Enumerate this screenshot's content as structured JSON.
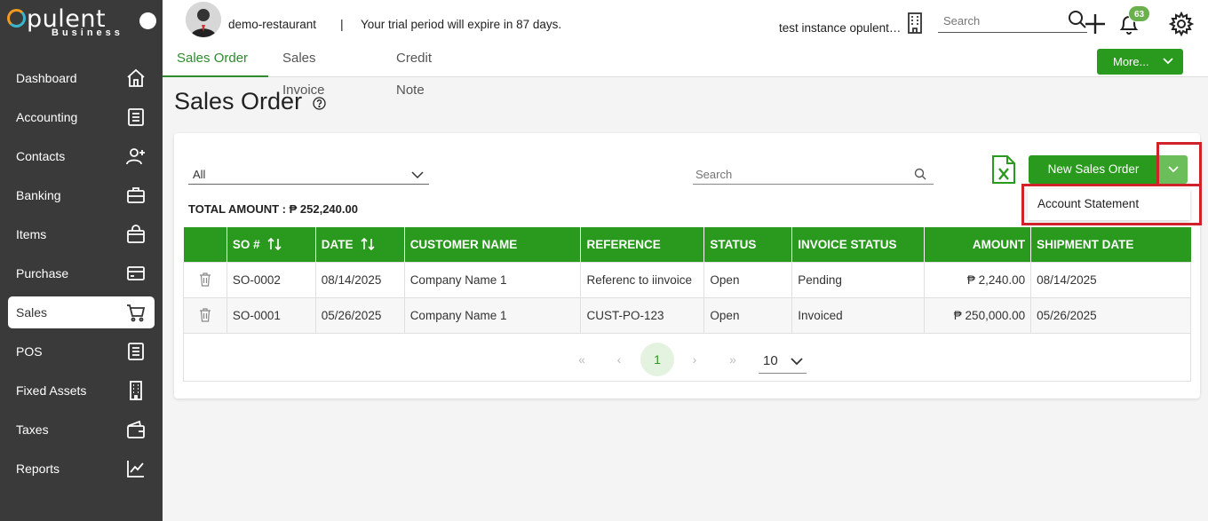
{
  "brand": {
    "name": "opulent",
    "sub": "Business"
  },
  "sidebar": {
    "items": [
      {
        "label": "Dashboard",
        "icon": "home-icon"
      },
      {
        "label": "Accounting",
        "icon": "ledger-icon"
      },
      {
        "label": "Contacts",
        "icon": "user-plus-icon"
      },
      {
        "label": "Banking",
        "icon": "briefcase-icon"
      },
      {
        "label": "Items",
        "icon": "shopping-bag-icon"
      },
      {
        "label": "Purchase",
        "icon": "credit-card-icon"
      },
      {
        "label": "Sales",
        "icon": "cart-icon",
        "active": true
      },
      {
        "label": "POS",
        "icon": "ledger-icon"
      },
      {
        "label": "Fixed Assets",
        "icon": "building-icon"
      },
      {
        "label": "Taxes",
        "icon": "wallet-icon"
      },
      {
        "label": "Reports",
        "icon": "chart-icon"
      }
    ]
  },
  "header": {
    "org": "demo-restaurant",
    "separator": "|",
    "trial": "Your trial period will expire in 87 days.",
    "instance": "test instance opulent business",
    "search_placeholder": "Search",
    "notification_count": "63"
  },
  "tabs": [
    "Sales Order",
    "Sales Invoice",
    "Credit Note"
  ],
  "more_label": "More...",
  "page": {
    "title": "Sales Order",
    "filter_value": "All",
    "search_placeholder": "Search",
    "new_button": "New Sales Order",
    "dropdown_item": "Account Statement",
    "total_label": "TOTAL AMOUNT : ₱ 252,240.00"
  },
  "table": {
    "columns": [
      "SO #",
      "DATE",
      "CUSTOMER NAME",
      "REFERENCE",
      "STATUS",
      "INVOICE STATUS",
      "AMOUNT",
      "SHIPMENT DATE"
    ],
    "rows": [
      {
        "so": "SO-0002",
        "date": "08/14/2025",
        "customer": "Company Name 1",
        "reference": "Referenc to iinvoice",
        "status": "Open",
        "invoice_status": "Pending",
        "amount": "₱ 2,240.00",
        "shipment": "08/14/2025"
      },
      {
        "so": "SO-0001",
        "date": "05/26/2025",
        "customer": "Company Name 1",
        "reference": "CUST-PO-123",
        "status": "Open",
        "invoice_status": "Invoiced",
        "amount": "₱ 250,000.00",
        "shipment": "05/26/2025"
      }
    ]
  },
  "pagination": {
    "first": "«",
    "prev": "‹",
    "current": "1",
    "next": "›",
    "last": "»",
    "page_size": "10"
  },
  "colors": {
    "primary": "#2a9a1e",
    "sidebar": "#3a3a3a",
    "highlight": "#d0222a"
  }
}
